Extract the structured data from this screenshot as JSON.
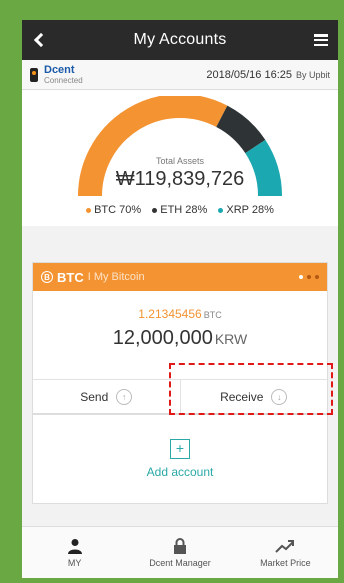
{
  "header": {
    "title": "My Accounts",
    "back_icon": "back-arrow-icon",
    "menu_icon": "hamburger-menu-icon"
  },
  "device": {
    "name": "Dcent",
    "status": "Connected",
    "datetime": "2018/05/16 16:25",
    "source": "By Upbit"
  },
  "assets": {
    "label": "Total Assets",
    "value": "₩119,839,726",
    "legend": [
      {
        "name": "BTC",
        "percent": "70%",
        "color": "#f39332"
      },
      {
        "name": "ETH",
        "percent": "28%",
        "color": "#333333"
      },
      {
        "name": "XRP",
        "percent": "28%",
        "color": "#1ca8b0"
      }
    ]
  },
  "account": {
    "symbol": "BTC",
    "description": "I My Bitcoin",
    "balance_btc": "1.21345456",
    "unit_btc": "BTC",
    "balance_krw": "12,000,000",
    "unit_krw": "KRW",
    "send_label": "Send",
    "receive_label": "Receive"
  },
  "add_account": {
    "label": "Add account",
    "icon": "+"
  },
  "nav": [
    {
      "label": "MY",
      "icon": "person-icon"
    },
    {
      "label": "Dcent Manager",
      "icon": "lock-icon"
    },
    {
      "label": "Market Price",
      "icon": "trend-icon"
    }
  ],
  "colors": {
    "accent": "#f39332",
    "teal": "#2aa8a8",
    "highlight": "#e01818",
    "background": "#6aa843"
  }
}
